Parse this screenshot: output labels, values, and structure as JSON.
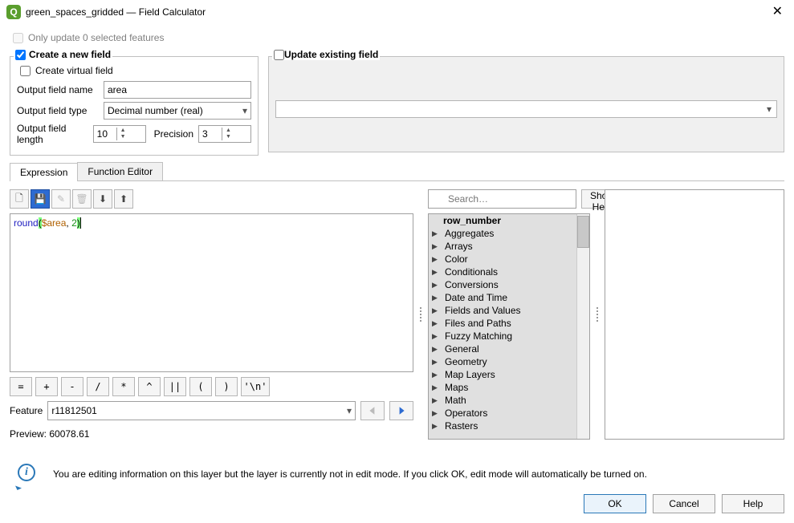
{
  "title": "green_spaces_gridded — Field Calculator",
  "only_update": {
    "checked": false,
    "label": "Only update 0 selected features"
  },
  "create_field": {
    "checked": true,
    "label": "Create a new field",
    "virtual": {
      "checked": false,
      "label": "Create virtual field"
    },
    "name_label": "Output field name",
    "name_value": "area",
    "type_label": "Output field type",
    "type_value": "Decimal number (real)",
    "length_label": "Output field length",
    "length_value": "10",
    "precision_label": "Precision",
    "precision_value": "3"
  },
  "update_field": {
    "checked": false,
    "label": "Update existing field"
  },
  "tabs": {
    "expression": "Expression",
    "function_editor": "Function Editor",
    "active": "expression"
  },
  "toolbar_icons": [
    "new-file-icon",
    "save-icon",
    "edit-icon",
    "delete-icon",
    "import-icon",
    "export-icon"
  ],
  "expression": {
    "fn": "round",
    "p1": "(",
    "var": "$area",
    "comma": ", ",
    "num": "2",
    "p2": ")"
  },
  "operators": [
    "=",
    "+",
    "-",
    "/",
    "*",
    "^",
    "||",
    "(",
    ")",
    "'\\n'"
  ],
  "feature": {
    "label": "Feature",
    "value": "r11812501"
  },
  "preview": {
    "label": "Preview:",
    "value": "60078.61"
  },
  "search": {
    "placeholder": "Search…",
    "show_help": "Show Help"
  },
  "tree": {
    "first": "row_number",
    "items": [
      "Aggregates",
      "Arrays",
      "Color",
      "Conditionals",
      "Conversions",
      "Date and Time",
      "Fields and Values",
      "Files and Paths",
      "Fuzzy Matching",
      "General",
      "Geometry",
      "Map Layers",
      "Maps",
      "Math",
      "Operators",
      "Rasters"
    ]
  },
  "info_text": "You are editing information on this layer but the layer is currently not in edit mode. If you click OK, edit mode will automatically be turned on.",
  "buttons": {
    "ok": "OK",
    "cancel": "Cancel",
    "help": "Help"
  }
}
